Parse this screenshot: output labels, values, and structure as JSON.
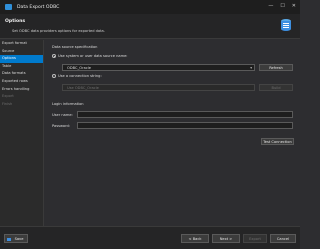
{
  "window": {
    "title": "Data Export ODBC",
    "controls": [
      "—",
      "☐",
      "✕"
    ]
  },
  "header": {
    "title": "Options",
    "description": "Set ODBC data providers options for exported data."
  },
  "sidebar": {
    "items": [
      {
        "label": "Export format",
        "active": false,
        "disabled": false
      },
      {
        "label": "Source",
        "active": false,
        "disabled": false
      },
      {
        "label": "Options",
        "active": true,
        "disabled": false
      },
      {
        "label": "Table",
        "active": false,
        "disabled": false
      },
      {
        "label": "Data formats",
        "active": false,
        "disabled": false
      },
      {
        "label": "Exported rows",
        "active": false,
        "disabled": false
      },
      {
        "label": "Errors handling",
        "active": false,
        "disabled": false
      },
      {
        "label": "Export",
        "active": false,
        "disabled": true
      },
      {
        "label": "Finish",
        "active": false,
        "disabled": true
      }
    ]
  },
  "datasource": {
    "section_label": "Data source specification",
    "radio_dsn_label": "Use system or user data source name:",
    "dsn_value": "ODBC_Oracle",
    "refresh_label": "Refresh",
    "radio_conn_label": "Use a connection string:",
    "conn_value": "Use ODBC_Oracle",
    "build_label": "Build"
  },
  "login": {
    "section_label": "Login information",
    "user_label": "User name:",
    "user_value": "",
    "password_label": "Password:",
    "password_value": "",
    "test_label": "Test Connection"
  },
  "footer": {
    "save_label": "Save",
    "back_label": "< Back",
    "next_label": "Next >",
    "export_label": "Export",
    "cancel_label": "Cancel"
  },
  "colors": {
    "accent": "#007acc",
    "background": "#2d2d30"
  }
}
